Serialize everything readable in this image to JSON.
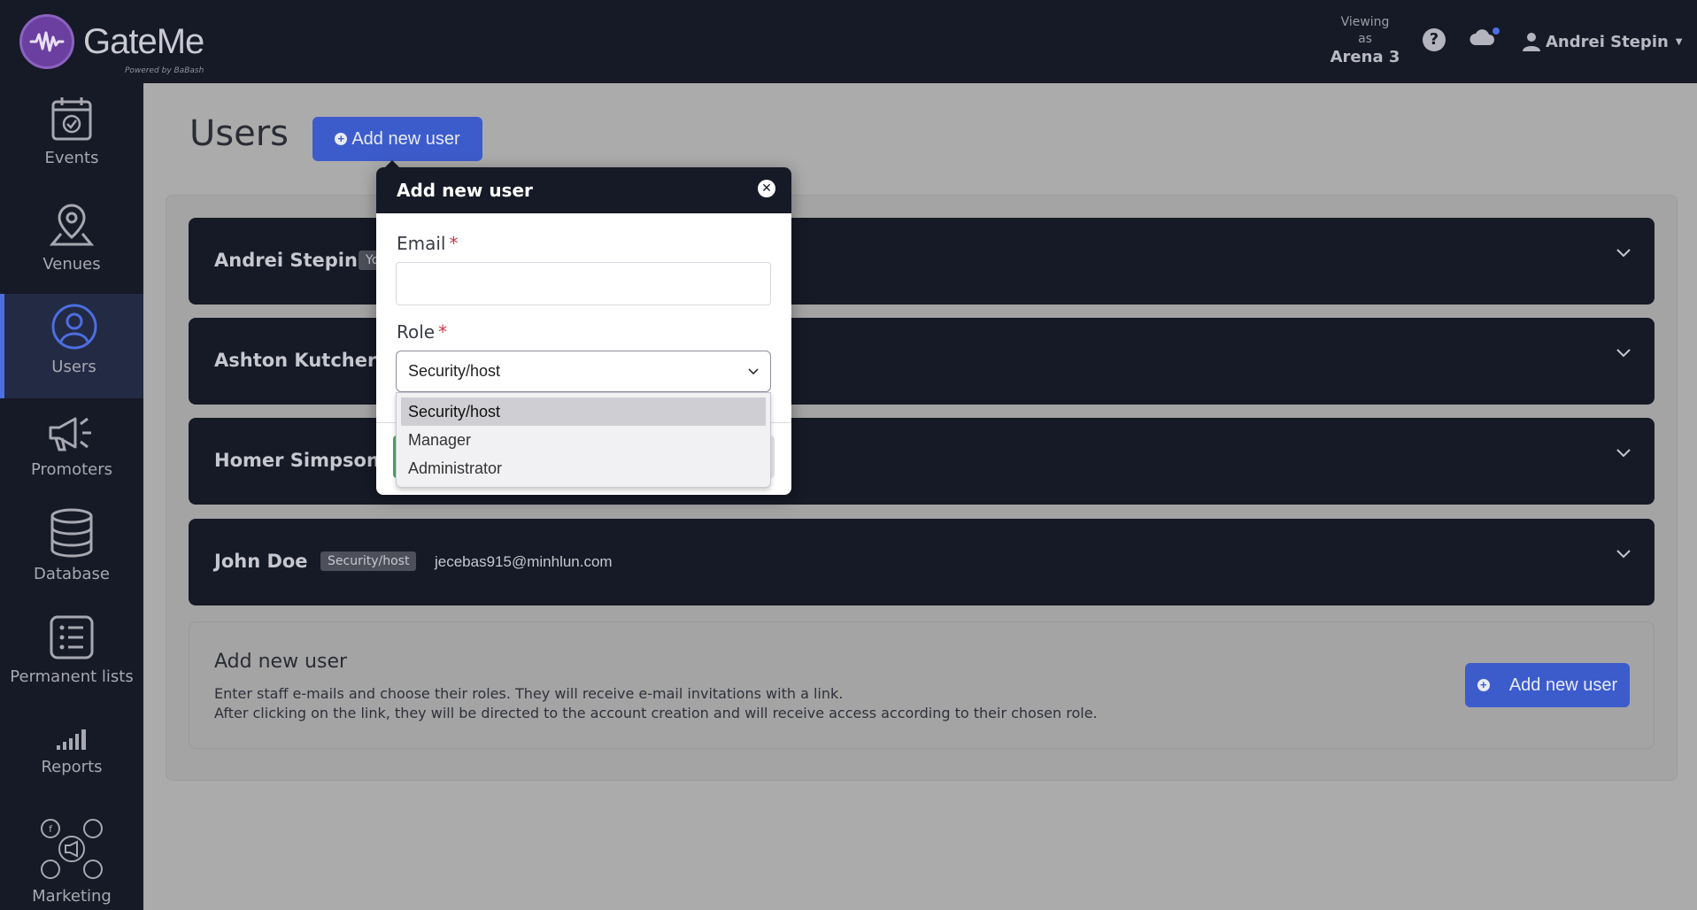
{
  "header": {
    "logo_name": "GateMe",
    "logo_sub": "Powered by BaBash",
    "viewing_label_1": "Viewing",
    "viewing_label_2": "as",
    "venue": "Arena 3",
    "help_glyph": "?",
    "user_name": "Andrei Stepin"
  },
  "sidebar": {
    "items": [
      {
        "label": "Events",
        "icon": "calendar-check-icon"
      },
      {
        "label": "Venues",
        "icon": "map-pin-icon"
      },
      {
        "label": "Users",
        "icon": "user-circle-icon",
        "active": true
      },
      {
        "label": "Promoters",
        "icon": "megaphone-icon"
      },
      {
        "label": "Database",
        "icon": "database-icon"
      },
      {
        "label": "Permanent lists",
        "icon": "list-icon"
      },
      {
        "label": "Reports",
        "icon": "signal-bars-icon"
      },
      {
        "label": "Marketing",
        "icon": "social-icon"
      }
    ]
  },
  "main": {
    "title": "Users",
    "add_button_label": "Add new user",
    "users": [
      {
        "name": "Andrei Stepin",
        "badge": "Yo",
        "email": ""
      },
      {
        "name": "Ashton Kutcher",
        "badge": "",
        "email": ""
      },
      {
        "name": "Homer Simpson",
        "badge": "",
        "email": ""
      },
      {
        "name": "John Doe",
        "badge": "Security/host",
        "email": "jecebas915@minhlun.com"
      }
    ],
    "add_card": {
      "title": "Add new user",
      "desc_line1": "Enter staff e-mails and choose their roles. They will receive e-mail invitations with a link.",
      "desc_line2": "After clicking on the link, they will be directed to the account creation and will receive access according to their chosen role.",
      "button_label": "Add new user"
    }
  },
  "popover": {
    "title": "Add new user",
    "close_glyph": "✕",
    "email_label": "Email",
    "email_value": "",
    "required_mark": "*",
    "role_label": "Role",
    "role_selected": "Security/host",
    "role_options": [
      "Security/host",
      "Manager",
      "Administrator"
    ]
  },
  "colors": {
    "dark": "#161a26",
    "accent": "#3c5ccc",
    "required": "#d0364a"
  }
}
